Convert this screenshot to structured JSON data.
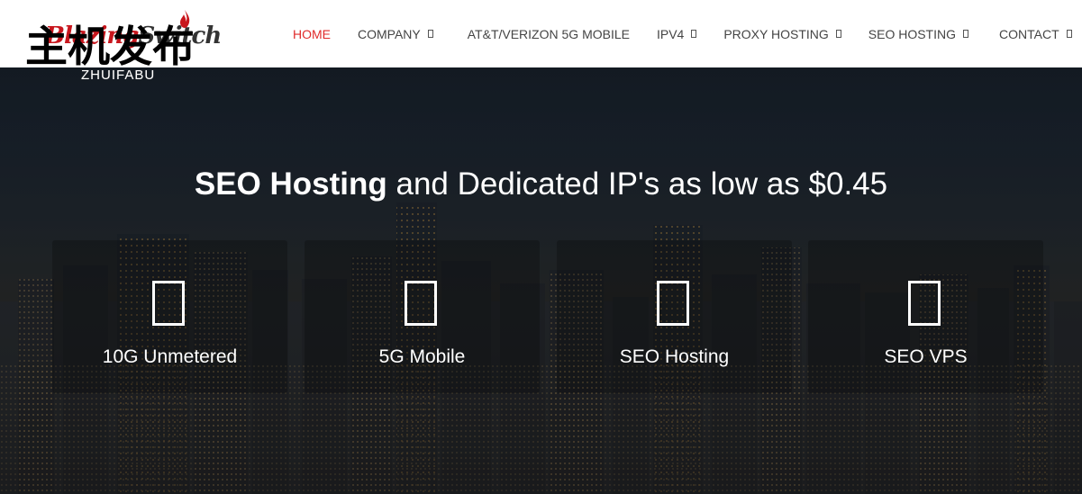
{
  "logo": {
    "script_part1": "Blazing",
    "script_part2": "Switch",
    "watermark_cn": "主机发布",
    "watermark_sub": "ZHUIFABU"
  },
  "nav": {
    "items": [
      {
        "label": "HOME",
        "active": true,
        "dropdown": false
      },
      {
        "label": "COMPANY",
        "active": false,
        "dropdown": true
      },
      {
        "label": "AT&T/VERIZON 5G MOBILE",
        "active": false,
        "dropdown": false
      },
      {
        "label": "IPV4",
        "active": false,
        "dropdown": true
      },
      {
        "label": "PROXY HOSTING",
        "active": false,
        "dropdown": true
      },
      {
        "label": "SEO HOSTING",
        "active": false,
        "dropdown": true
      },
      {
        "label": "CONTACT",
        "active": false,
        "dropdown": true
      }
    ]
  },
  "hero": {
    "title_bold": "SEO Hosting",
    "title_rest": " and Dedicated IP's as low as $0.45",
    "cards": [
      {
        "label": "10G Unmetered",
        "icon": "missing-glyph-icon"
      },
      {
        "label": "5G Mobile",
        "icon": "missing-glyph-icon"
      },
      {
        "label": "SEO Hosting",
        "icon": "missing-glyph-icon"
      },
      {
        "label": "SEO VPS",
        "icon": "missing-glyph-icon"
      }
    ]
  },
  "colors": {
    "accent": "#e02b2b",
    "nav_text": "#444444",
    "header_bg": "#ffffff",
    "hero_text": "#ffffff"
  }
}
